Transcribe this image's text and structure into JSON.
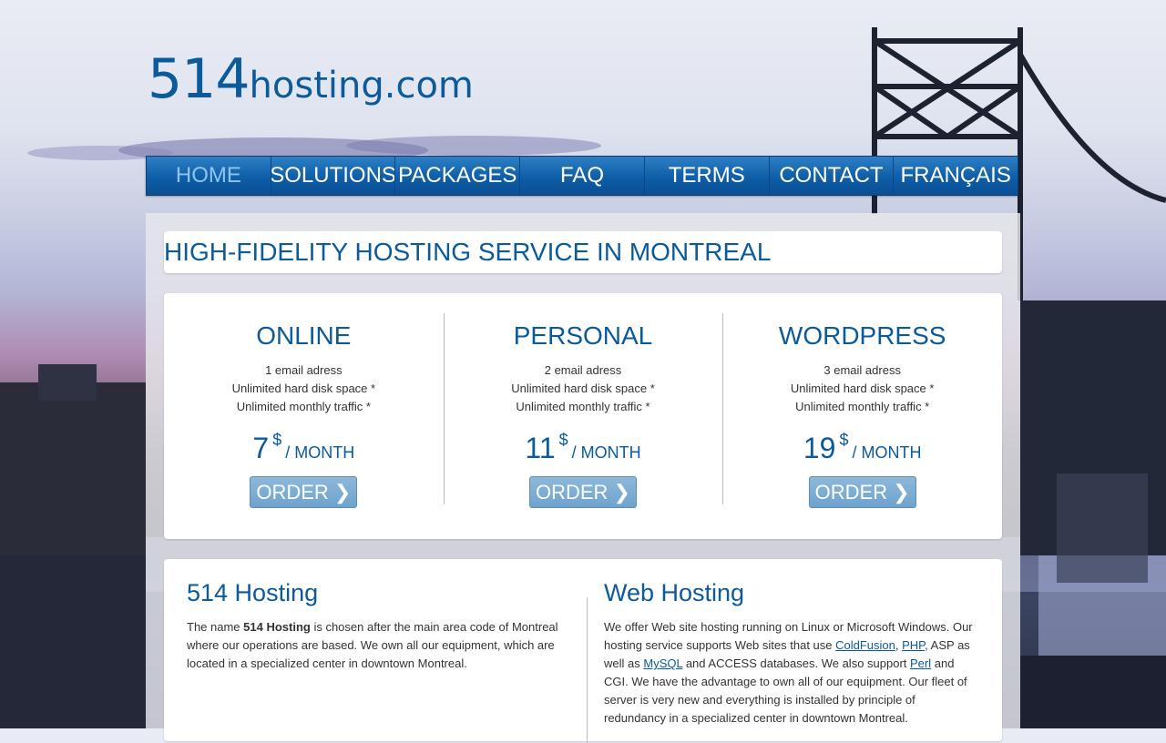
{
  "logo": {
    "digits": "514",
    "text": "hosting.com"
  },
  "nav": [
    "HOME",
    "SOLUTIONS",
    "PACKAGES",
    "FAQ",
    "TERMS",
    "CONTACT",
    "FRANÇAIS"
  ],
  "headline": "HIGH-FIDELITY HOSTING SERVICE IN MONTREAL",
  "plans": [
    {
      "name": "ONLINE",
      "features": [
        "1 email adress",
        "Unlimited hard disk space *",
        "Unlimited monthly traffic *"
      ],
      "price": "7",
      "currency": "$",
      "period": "/ MONTH",
      "button": "ORDER ❯"
    },
    {
      "name": "PERSONAL",
      "features": [
        "2 email adress",
        "Unlimited hard disk space *",
        "Unlimited monthly traffic *"
      ],
      "price": "11",
      "currency": "$",
      "period": "/ MONTH",
      "button": "ORDER ❯"
    },
    {
      "name": "WORDPRESS",
      "features": [
        "3 email adress",
        "Unlimited hard disk space *",
        "Unlimited monthly traffic *"
      ],
      "price": "19",
      "currency": "$",
      "period": "/ MONTH",
      "button": "ORDER ❯"
    }
  ],
  "about": {
    "title": "514 Hosting",
    "p1": "The name ",
    "bold": "514 Hosting",
    "p2": " is chosen after the main area code of Montreal where our operations are based. We own all our equipment, which are located in a specialized center in downtown Montreal."
  },
  "webhosting": {
    "title": "Web Hosting",
    "t1": "We offer Web site hosting running on Linux or Microsoft Windows. Our hosting service supports Web sites that use ",
    "link1": "ColdFusion",
    "t2": ", ",
    "link2": "PHP",
    "t3": ", ASP as well as ",
    "link3": "MySQL",
    "t4": " and ACCESS databases. We also support ",
    "link4": "Perl",
    "t5": " and CGI. We have the advantage to own all of our equipment. Our fleet of server is very new and everything is installed by principle of redundancy in a specialized center in downtown Montreal."
  }
}
